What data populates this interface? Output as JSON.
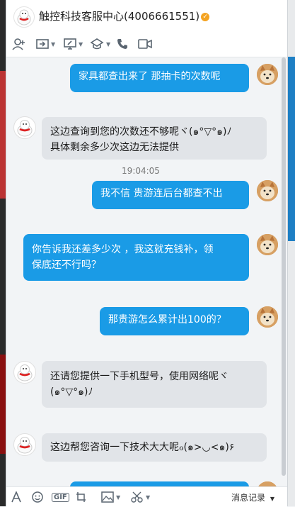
{
  "window": {
    "title": "触控科技客服中心(4006661551)",
    "verified_icon": "verified-badge-icon"
  },
  "toolbar": {
    "icons": [
      "add-friend-icon",
      "share-screen-icon",
      "remote-desktop-icon",
      "app-center-icon",
      "phone-icon",
      "video-icon"
    ]
  },
  "messages": [
    {
      "from": "user",
      "text": "家具都查出来了 那抽卡的次数呢"
    },
    {
      "from": "service",
      "lines": [
        "这边查询到您的次数还不够呢ヾ(๑°▽°๑)ﾉ",
        "具体剩余多少次这边无法提供"
      ]
    },
    {
      "type": "timestamp",
      "text": "19:04:05"
    },
    {
      "from": "user",
      "text": "我不信 贵游连后台都查不出"
    },
    {
      "from": "user",
      "lines": [
        "你告诉我还差多少次 ，我这就充钱补，领",
        "保底还不行吗？"
      ]
    },
    {
      "from": "user",
      "text": "那贵游怎么累计出100的？"
    },
    {
      "from": "service",
      "lines": [
        "还请您提供一下手机型号，使用网络呢ヾ",
        "(๑°▽°๑)ﾉ"
      ]
    },
    {
      "from": "service",
      "text": "这边帮您咨询一下技术大大呢ℴ(๑>◡<๑)۶"
    }
  ],
  "bottombar": {
    "message_record": "消息记录",
    "icons": [
      "font-icon",
      "emoji-icon",
      "gif-icon",
      "screenshot-icon",
      "image-icon",
      "scissors-icon"
    ],
    "gif_label": "GIF"
  },
  "colors": {
    "accent": "#1a9be6",
    "incoming_bubble": "#e1e4e8",
    "chat_bg": "#f2f4f6"
  }
}
